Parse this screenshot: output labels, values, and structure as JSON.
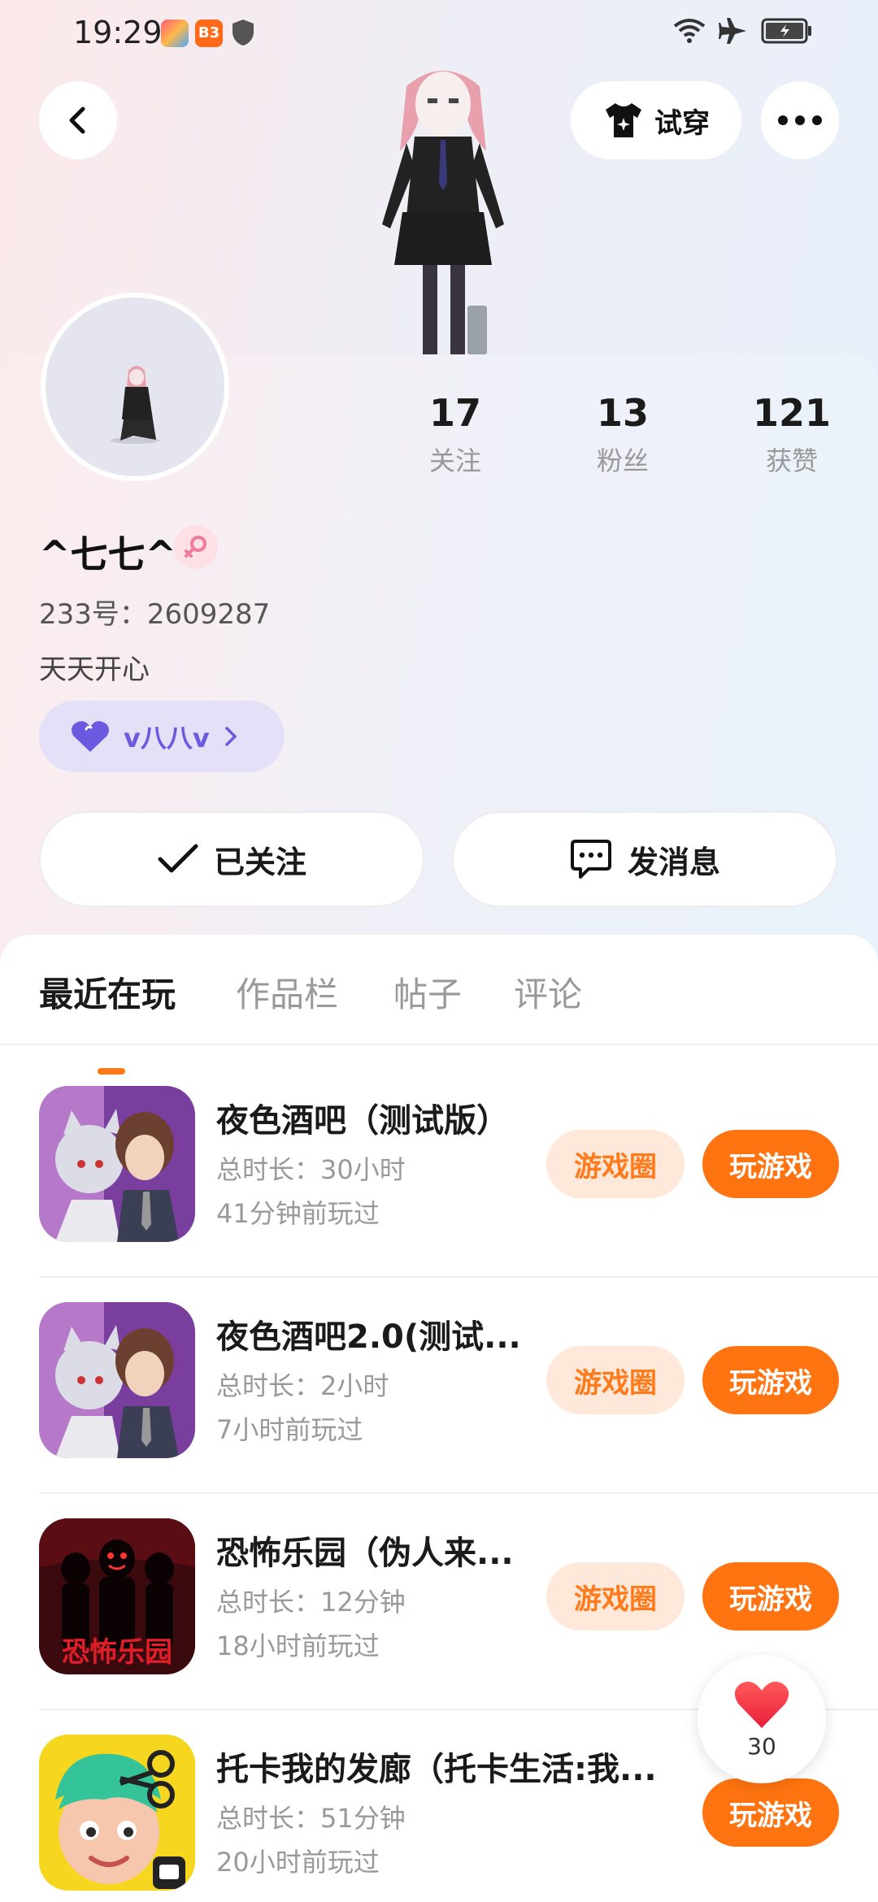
{
  "status_bar": {
    "time": "19:29",
    "app_badge": "B3"
  },
  "header": {
    "try_on_label": "试穿"
  },
  "profile": {
    "stats": [
      {
        "value": "17",
        "label": "关注"
      },
      {
        "value": "13",
        "label": "粉丝"
      },
      {
        "value": "121",
        "label": "获赞"
      }
    ],
    "username": "^七七^",
    "gender": "female",
    "uid_label": "233号：2609287",
    "bio": "天天开心",
    "guild_name": "v八八v",
    "follow_label": "已关注",
    "message_label": "发消息"
  },
  "tabs": [
    {
      "label": "最近在玩",
      "active": true
    },
    {
      "label": "作品栏",
      "active": false
    },
    {
      "label": "帖子",
      "active": false
    },
    {
      "label": "评论",
      "active": false
    }
  ],
  "games": [
    {
      "name": "夜色酒吧（测试版）",
      "duration": "总时长：30小时",
      "last_played": "41分钟前玩过",
      "circle_label": "游戏圈",
      "play_label": "玩游戏",
      "has_circle": true
    },
    {
      "name": "夜色酒吧2.0(测试...",
      "duration": "总时长：2小时",
      "last_played": "7小时前玩过",
      "circle_label": "游戏圈",
      "play_label": "玩游戏",
      "has_circle": true
    },
    {
      "name": "恐怖乐园（伪人来...",
      "duration": "总时长：12分钟",
      "last_played": "18小时前玩过",
      "circle_label": "游戏圈",
      "play_label": "玩游戏",
      "has_circle": true,
      "icon_text": "恐怖乐园"
    },
    {
      "name": "托卡我的发廊（托卡生活:我...",
      "duration": "总时长：51分钟",
      "last_played": "20小时前玩过",
      "circle_label": "",
      "play_label": "玩游戏",
      "has_circle": false
    }
  ],
  "like_fab": {
    "count": "30"
  },
  "colors": {
    "accent": "#ff7410",
    "circle_bg": "#fde8da",
    "guild_purple": "#6b5ae0"
  }
}
